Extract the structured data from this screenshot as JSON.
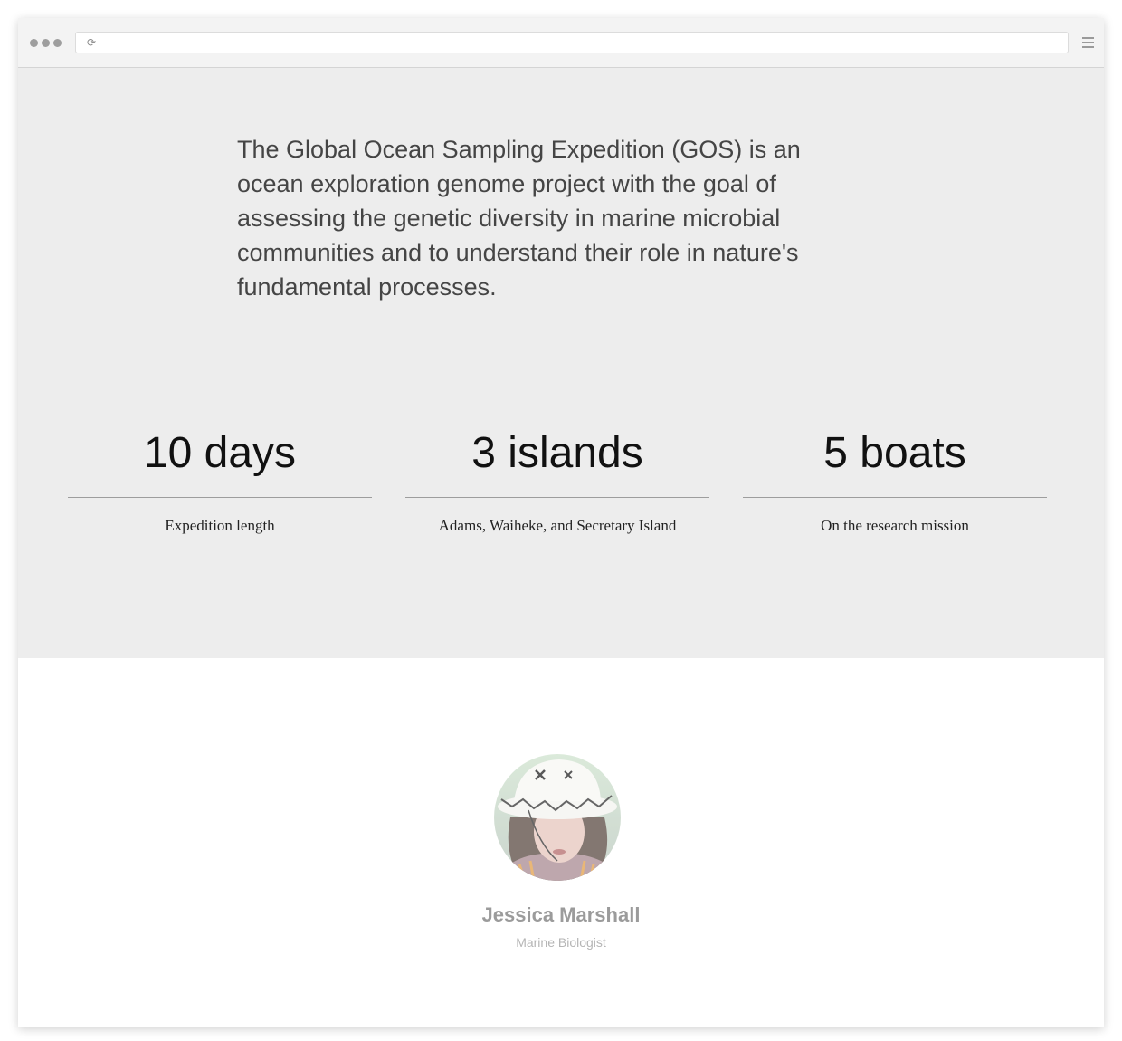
{
  "browser": {
    "reload_icon": "reload-icon",
    "menu_icon": "hamburger-menu-icon"
  },
  "hero": {
    "intro": "The Global Ocean Sampling Expedition (GOS) is an ocean exploration genome project with the goal of assessing the genetic diversity in marine microbial communities and to understand their role in nature's fundamental processes."
  },
  "stats": [
    {
      "value": "10 days",
      "label": "Expedition length"
    },
    {
      "value": "3 islands",
      "label": "Adams, Waiheke, and Secretary Island"
    },
    {
      "value": "5 boats",
      "label": "On the research mission"
    }
  ],
  "profile": {
    "name": "Jessica Marshall",
    "role": "Marine Biologist"
  },
  "colors": {
    "hero_background": "#ededed",
    "page_background": "#ffffff",
    "intro_text": "#454545",
    "name_text": "#9b9b9b"
  }
}
